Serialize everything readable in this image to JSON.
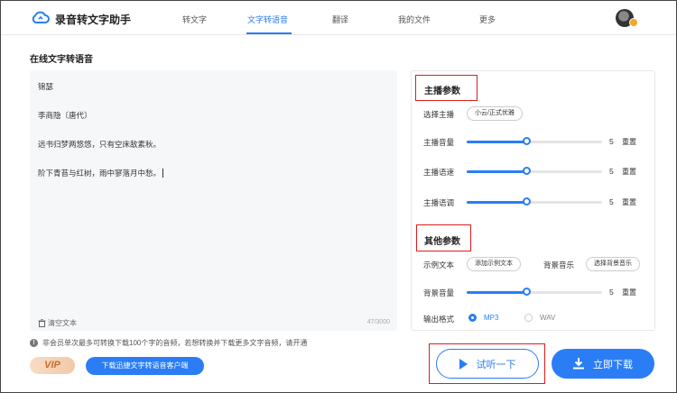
{
  "app": {
    "brand": "录音转文字助手"
  },
  "nav": [
    {
      "label": "转文字",
      "active": false
    },
    {
      "label": "文字转语音",
      "active": true
    },
    {
      "label": "翻译",
      "active": false
    },
    {
      "label": "我的文件",
      "active": false
    },
    {
      "label": "更多",
      "active": false
    }
  ],
  "page": {
    "title": "在线文字转语音"
  },
  "editor": {
    "lines": [
      "锦瑟",
      "李商隐〔唐代〕",
      "远书归梦两悠悠，只有空床敌素秋。",
      "阶下青苔与红树，雨中寥落月中愁。"
    ],
    "clear_label": "清空文本",
    "counter": "47/3000"
  },
  "notice": {
    "text": "非会员单次最多可转换下载100个字的音频，若想转换并下载更多文字音频，请开通"
  },
  "vip": {
    "label": "VIP"
  },
  "client_download": {
    "label": "下载迅捷文字转语音客户端"
  },
  "anchor_params": {
    "title": "主播参数",
    "select_label": "选择主播",
    "select_value": "小云/正式优雅",
    "volume": {
      "label": "主播音量",
      "value": "5",
      "level": 0.44,
      "reset": "重置"
    },
    "speed": {
      "label": "主播语速",
      "value": "5",
      "level": 0.44,
      "reset": "重置"
    },
    "pitch": {
      "label": "主播语调",
      "value": "5",
      "level": 0.44,
      "reset": "重置"
    }
  },
  "other_params": {
    "title": "其他参数",
    "example_label": "示例文本",
    "example_button": "添加示例文本",
    "bgm_label": "背景音乐",
    "bgm_button": "选择背景音乐",
    "bg_volume": {
      "label": "背景音量",
      "value": "5",
      "level": 0.44,
      "reset": "重置"
    },
    "format_label": "输出格式",
    "formats": [
      {
        "label": "MP3",
        "selected": true
      },
      {
        "label": "WAV",
        "selected": false
      }
    ]
  },
  "actions": {
    "try_label": "试听一下",
    "download_label": "立即下载"
  },
  "colors": {
    "accent": "#2a7df5",
    "highlight": "#e11b1b"
  }
}
